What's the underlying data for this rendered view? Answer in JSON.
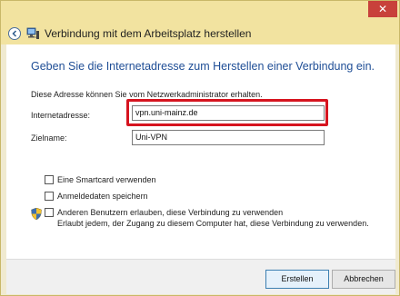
{
  "window": {
    "close_glyph": "✕"
  },
  "header": {
    "title": "Verbindung mit dem Arbeitsplatz herstellen",
    "back_icon": "back-arrow-icon",
    "app_icon": "network-computer-icon"
  },
  "main": {
    "heading": "Geben Sie die Internetadresse zum Herstellen einer Verbindung ein.",
    "info": "Diese Adresse können Sie vom Netzwerkadministrator erhalten.",
    "fields": {
      "address_label": "Internetadresse:",
      "address_value": "vpn.uni-mainz.de",
      "dest_label": "Zielname:",
      "dest_value": "Uni-VPN"
    },
    "options": {
      "smartcard": "Eine Smartcard verwenden",
      "remember": "Anmeldedaten speichern",
      "allow_others": "Anderen Benutzern erlauben, diese Verbindung zu verwenden",
      "allow_others_desc": "Erlaubt jedem, der Zugang zu diesem Computer hat, diese Verbindung zu verwenden."
    }
  },
  "footer": {
    "create_label": "Erstellen",
    "cancel_label": "Abbrechen"
  },
  "colors": {
    "accent": "#1f4e96",
    "highlight": "#d6141f",
    "titlebar": "#f2e3a0"
  }
}
